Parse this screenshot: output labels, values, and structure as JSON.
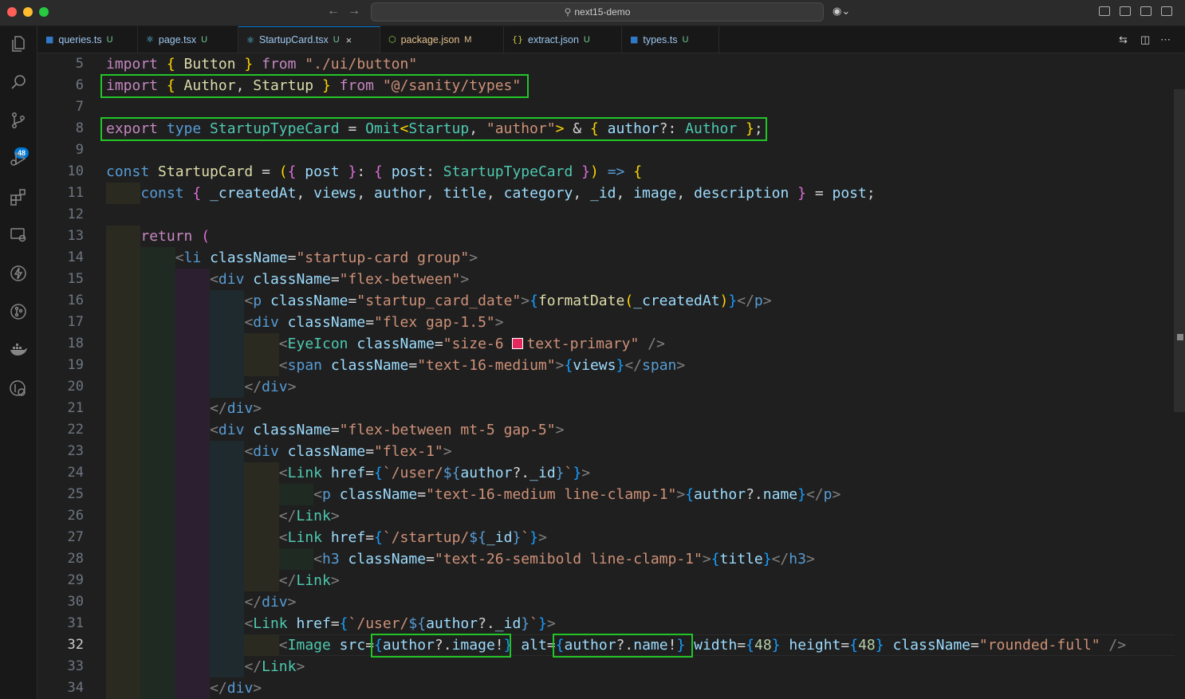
{
  "window": {
    "title": "next15-demo",
    "colors": {
      "accent": "#0078d4",
      "highlight_box": "#22c528"
    }
  },
  "activity_bar": {
    "items": [
      {
        "name": "explorer-icon"
      },
      {
        "name": "search-icon"
      },
      {
        "name": "source-control-icon",
        "badge": "48"
      },
      {
        "name": "run-debug-icon"
      },
      {
        "name": "extensions-icon"
      },
      {
        "name": "remote-explorer-icon"
      },
      {
        "name": "thunder-client-icon"
      },
      {
        "name": "git-graph-icon"
      },
      {
        "name": "docker-icon"
      },
      {
        "name": "gitlens-icon"
      }
    ]
  },
  "tabs": [
    {
      "label": "queries.ts",
      "status": "U",
      "icon": "ts"
    },
    {
      "label": "page.tsx",
      "status": "U",
      "icon": "react"
    },
    {
      "label": "StartupCard.tsx",
      "status": "U",
      "icon": "react",
      "active": true
    },
    {
      "label": "package.json",
      "status": "M",
      "icon": "node"
    },
    {
      "label": "extract.json",
      "status": "U",
      "icon": "json"
    },
    {
      "label": "types.ts",
      "status": "U",
      "icon": "ts"
    }
  ],
  "editor": {
    "line_numbers": [
      "5",
      "6",
      "7",
      "8",
      "9",
      "10",
      "11",
      "12",
      "13",
      "14",
      "15",
      "16",
      "17",
      "18",
      "19",
      "20",
      "21",
      "22",
      "23",
      "24",
      "25",
      "26",
      "27",
      "28",
      "29",
      "30",
      "31",
      "32",
      "33",
      "34"
    ],
    "current_line": "32",
    "lines": [
      [
        [
          "kw",
          "import "
        ],
        [
          "br1",
          "{ "
        ],
        [
          "fn",
          "Button"
        ],
        [
          "br1",
          " }"
        ],
        [
          "kw",
          " from "
        ],
        [
          "st",
          "\"./ui/button\""
        ]
      ],
      [
        [
          "kw",
          "import "
        ],
        [
          "br1",
          "{ "
        ],
        [
          "fn",
          "Author"
        ],
        [
          "tx",
          ", "
        ],
        [
          "fn",
          "Startup"
        ],
        [
          "br1",
          " }"
        ],
        [
          "kw",
          " from "
        ],
        [
          "st",
          "\"@/sanity/types\""
        ]
      ],
      [],
      [
        [
          "kw",
          "export "
        ],
        [
          "kb",
          "type "
        ],
        [
          "ty",
          "StartupTypeCard"
        ],
        [
          "tx",
          " = "
        ],
        [
          "ty",
          "Omit"
        ],
        [
          "br1",
          "<"
        ],
        [
          "ty",
          "Startup"
        ],
        [
          "tx",
          ", "
        ],
        [
          "st",
          "\"author\""
        ],
        [
          "br1",
          ">"
        ],
        [
          "tx",
          " & "
        ],
        [
          "br1",
          "{ "
        ],
        [
          "va",
          "author"
        ],
        [
          "tx",
          "?: "
        ],
        [
          "ty",
          "Author"
        ],
        [
          "br1",
          " }"
        ],
        [
          "tx",
          ";"
        ]
      ],
      [],
      [
        [
          "kb",
          "const "
        ],
        [
          "fn",
          "StartupCard"
        ],
        [
          "tx",
          " = "
        ],
        [
          "br1",
          "("
        ],
        [
          "br2",
          "{ "
        ],
        [
          "va",
          "post"
        ],
        [
          "br2",
          " }"
        ],
        [
          "tx",
          ": "
        ],
        [
          "br2",
          "{ "
        ],
        [
          "va",
          "post"
        ],
        [
          "tx",
          ": "
        ],
        [
          "ty",
          "StartupTypeCard"
        ],
        [
          "br2",
          " }"
        ],
        [
          "br1",
          ")"
        ],
        [
          "kb",
          " => "
        ],
        [
          "br1",
          "{"
        ]
      ],
      [
        [
          "kb",
          "const "
        ],
        [
          "br2",
          "{ "
        ],
        [
          "va",
          "_createdAt"
        ],
        [
          "tx",
          ", "
        ],
        [
          "va",
          "views"
        ],
        [
          "tx",
          ", "
        ],
        [
          "va",
          "author"
        ],
        [
          "tx",
          ", "
        ],
        [
          "va",
          "title"
        ],
        [
          "tx",
          ", "
        ],
        [
          "va",
          "category"
        ],
        [
          "tx",
          ", "
        ],
        [
          "va",
          "_id"
        ],
        [
          "tx",
          ", "
        ],
        [
          "va",
          "image"
        ],
        [
          "tx",
          ", "
        ],
        [
          "va",
          "description"
        ],
        [
          "br2",
          " }"
        ],
        [
          "tx",
          " = "
        ],
        [
          "va",
          "post"
        ],
        [
          "tx",
          ";"
        ]
      ],
      [],
      [
        [
          "kw",
          "return "
        ],
        [
          "br2",
          "("
        ]
      ],
      [
        [
          "tag",
          "<"
        ],
        [
          "tn",
          "li "
        ],
        [
          "at",
          "className"
        ],
        [
          "tx",
          "="
        ],
        [
          "st",
          "\"startup-card group\""
        ],
        [
          "tag",
          ">"
        ]
      ],
      [
        [
          "tag",
          "<"
        ],
        [
          "tn",
          "div "
        ],
        [
          "at",
          "className"
        ],
        [
          "tx",
          "="
        ],
        [
          "st",
          "\"flex-between\""
        ],
        [
          "tag",
          ">"
        ]
      ],
      [
        [
          "tag",
          "<"
        ],
        [
          "tn",
          "p "
        ],
        [
          "at",
          "className"
        ],
        [
          "tx",
          "="
        ],
        [
          "st",
          "\"startup_card_date\""
        ],
        [
          "tag",
          ">"
        ],
        [
          "br3",
          "{"
        ],
        [
          "fn",
          "formatDate"
        ],
        [
          "br1",
          "("
        ],
        [
          "va",
          "_createdAt"
        ],
        [
          "br1",
          ")"
        ],
        [
          "br3",
          "}"
        ],
        [
          "tag",
          "</"
        ],
        [
          "tn",
          "p"
        ],
        [
          "tag",
          ">"
        ]
      ],
      [
        [
          "tag",
          "<"
        ],
        [
          "tn",
          "div "
        ],
        [
          "at",
          "className"
        ],
        [
          "tx",
          "="
        ],
        [
          "st",
          "\"flex gap-1.5\""
        ],
        [
          "tag",
          ">"
        ]
      ],
      [
        [
          "tag",
          "<"
        ],
        [
          "tc",
          "EyeIcon "
        ],
        [
          "at",
          "className"
        ],
        [
          "tx",
          "="
        ],
        [
          "st",
          "\"size-6 "
        ],
        [
          "swatch",
          ""
        ],
        [
          "st",
          "text-primary\""
        ],
        [
          "tag",
          " />"
        ]
      ],
      [
        [
          "tag",
          "<"
        ],
        [
          "tn",
          "span "
        ],
        [
          "at",
          "className"
        ],
        [
          "tx",
          "="
        ],
        [
          "st",
          "\"text-16-medium\""
        ],
        [
          "tag",
          ">"
        ],
        [
          "br3",
          "{"
        ],
        [
          "va",
          "views"
        ],
        [
          "br3",
          "}"
        ],
        [
          "tag",
          "</"
        ],
        [
          "tn",
          "span"
        ],
        [
          "tag",
          ">"
        ]
      ],
      [
        [
          "tag",
          "</"
        ],
        [
          "tn",
          "div"
        ],
        [
          "tag",
          ">"
        ]
      ],
      [
        [
          "tag",
          "</"
        ],
        [
          "tn",
          "div"
        ],
        [
          "tag",
          ">"
        ]
      ],
      [
        [
          "tag",
          "<"
        ],
        [
          "tn",
          "div "
        ],
        [
          "at",
          "className"
        ],
        [
          "tx",
          "="
        ],
        [
          "st",
          "\"flex-between mt-5 gap-5\""
        ],
        [
          "tag",
          ">"
        ]
      ],
      [
        [
          "tag",
          "<"
        ],
        [
          "tn",
          "div "
        ],
        [
          "at",
          "className"
        ],
        [
          "tx",
          "="
        ],
        [
          "st",
          "\"flex-1\""
        ],
        [
          "tag",
          ">"
        ]
      ],
      [
        [
          "tag",
          "<"
        ],
        [
          "tc",
          "Link "
        ],
        [
          "at",
          "href"
        ],
        [
          "tx",
          "="
        ],
        [
          "br3",
          "{"
        ],
        [
          "st",
          "`/user/"
        ],
        [
          "kb",
          "${"
        ],
        [
          "va",
          "author"
        ],
        [
          "tx",
          "?."
        ],
        [
          "va",
          "_id"
        ],
        [
          "kb",
          "}"
        ],
        [
          "st",
          "`"
        ],
        [
          "br3",
          "}"
        ],
        [
          "tag",
          ">"
        ]
      ],
      [
        [
          "tag",
          "<"
        ],
        [
          "tn",
          "p "
        ],
        [
          "at",
          "className"
        ],
        [
          "tx",
          "="
        ],
        [
          "st",
          "\"text-16-medium line-clamp-1\""
        ],
        [
          "tag",
          ">"
        ],
        [
          "br3",
          "{"
        ],
        [
          "va",
          "author"
        ],
        [
          "tx",
          "?."
        ],
        [
          "va",
          "name"
        ],
        [
          "br3",
          "}"
        ],
        [
          "tag",
          "</"
        ],
        [
          "tn",
          "p"
        ],
        [
          "tag",
          ">"
        ]
      ],
      [
        [
          "tag",
          "</"
        ],
        [
          "tc",
          "Link"
        ],
        [
          "tag",
          ">"
        ]
      ],
      [
        [
          "tag",
          "<"
        ],
        [
          "tc",
          "Link "
        ],
        [
          "at",
          "href"
        ],
        [
          "tx",
          "="
        ],
        [
          "br3",
          "{"
        ],
        [
          "st",
          "`/startup/"
        ],
        [
          "kb",
          "${"
        ],
        [
          "va",
          "_id"
        ],
        [
          "kb",
          "}"
        ],
        [
          "st",
          "`"
        ],
        [
          "br3",
          "}"
        ],
        [
          "tag",
          ">"
        ]
      ],
      [
        [
          "tag",
          "<"
        ],
        [
          "tn",
          "h3 "
        ],
        [
          "at",
          "className"
        ],
        [
          "tx",
          "="
        ],
        [
          "st",
          "\"text-26-semibold line-clamp-1\""
        ],
        [
          "tag",
          ">"
        ],
        [
          "br3",
          "{"
        ],
        [
          "va",
          "title"
        ],
        [
          "br3",
          "}"
        ],
        [
          "tag",
          "</"
        ],
        [
          "tn",
          "h3"
        ],
        [
          "tag",
          ">"
        ]
      ],
      [
        [
          "tag",
          "</"
        ],
        [
          "tc",
          "Link"
        ],
        [
          "tag",
          ">"
        ]
      ],
      [
        [
          "tag",
          "</"
        ],
        [
          "tn",
          "div"
        ],
        [
          "tag",
          ">"
        ]
      ],
      [
        [
          "tag",
          "<"
        ],
        [
          "tc",
          "Link "
        ],
        [
          "at",
          "href"
        ],
        [
          "tx",
          "="
        ],
        [
          "br3",
          "{"
        ],
        [
          "st",
          "`/user/"
        ],
        [
          "kb",
          "${"
        ],
        [
          "va",
          "author"
        ],
        [
          "tx",
          "?."
        ],
        [
          "va",
          "_id"
        ],
        [
          "kb",
          "}"
        ],
        [
          "st",
          "`"
        ],
        [
          "br3",
          "}"
        ],
        [
          "tag",
          ">"
        ]
      ],
      [
        [
          "tag",
          "<"
        ],
        [
          "tc",
          "Image "
        ],
        [
          "at",
          "src"
        ],
        [
          "tx",
          "="
        ],
        [
          "br3",
          "{"
        ],
        [
          "va",
          "author"
        ],
        [
          "tx",
          "?."
        ],
        [
          "va",
          "image"
        ],
        [
          "tx",
          "!"
        ],
        [
          "br3",
          "}"
        ],
        [
          "tx",
          " "
        ],
        [
          "at",
          "alt"
        ],
        [
          "tx",
          "="
        ],
        [
          "br3",
          "{"
        ],
        [
          "va",
          "author"
        ],
        [
          "tx",
          "?."
        ],
        [
          "va",
          "name"
        ],
        [
          "tx",
          "!"
        ],
        [
          "br3",
          "}"
        ],
        [
          "tx",
          " "
        ],
        [
          "at",
          "width"
        ],
        [
          "tx",
          "="
        ],
        [
          "br3",
          "{"
        ],
        [
          "nu",
          "48"
        ],
        [
          "br3",
          "}"
        ],
        [
          "tx",
          " "
        ],
        [
          "at",
          "height"
        ],
        [
          "tx",
          "="
        ],
        [
          "br3",
          "{"
        ],
        [
          "nu",
          "48"
        ],
        [
          "br3",
          "}"
        ],
        [
          "tx",
          " "
        ],
        [
          "at",
          "className"
        ],
        [
          "tx",
          "="
        ],
        [
          "st",
          "\"rounded-full\""
        ],
        [
          "tag",
          " />"
        ]
      ],
      [
        [
          "tag",
          "</"
        ],
        [
          "tc",
          "Link"
        ],
        [
          "tag",
          ">"
        ]
      ],
      [
        [
          "tag",
          "</"
        ],
        [
          "tn",
          "div"
        ],
        [
          "tag",
          ">"
        ]
      ]
    ]
  }
}
